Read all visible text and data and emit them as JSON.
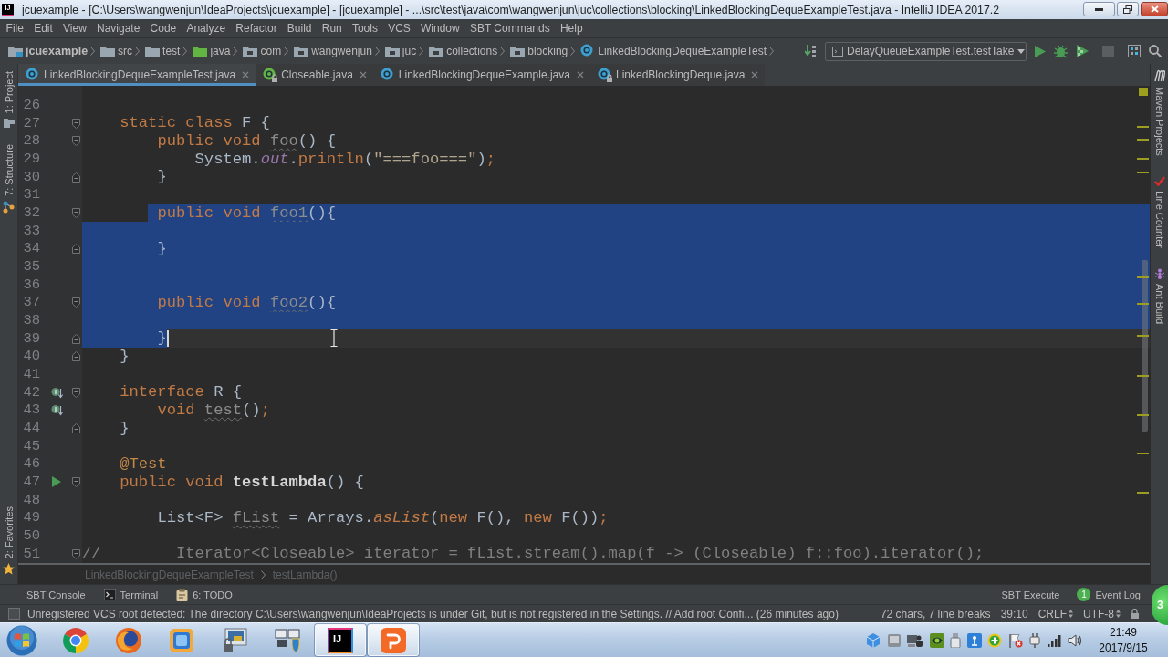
{
  "window": {
    "app_icon_text": "IJ",
    "title": "jcuexample - [C:\\Users\\wangwenjun\\IdeaProjects\\jcuexample] - [jcuexample] - ...\\src\\test\\java\\com\\wangwenjun\\juc\\collections\\blocking\\LinkedBlockingDequeExampleTest.java - IntelliJ IDEA 2017.2"
  },
  "menu": [
    "File",
    "Edit",
    "View",
    "Navigate",
    "Code",
    "Analyze",
    "Refactor",
    "Build",
    "Run",
    "Tools",
    "VCS",
    "Window",
    "SBT Commands",
    "Help"
  ],
  "breadcrumbs": [
    {
      "label": "jcuexample",
      "kind": "module"
    },
    {
      "label": "src",
      "kind": "folder"
    },
    {
      "label": "test",
      "kind": "folder"
    },
    {
      "label": "java",
      "kind": "source-root"
    },
    {
      "label": "com",
      "kind": "package"
    },
    {
      "label": "wangwenjun",
      "kind": "package"
    },
    {
      "label": "juc",
      "kind": "package"
    },
    {
      "label": "collections",
      "kind": "package"
    },
    {
      "label": "blocking",
      "kind": "package"
    },
    {
      "label": "LinkedBlockingDequeExampleTest",
      "kind": "class"
    }
  ],
  "toolbar": [
    {
      "kind": "binary-sort",
      "disabled": false
    },
    {
      "kind": "run-configuration",
      "label": "DelayQueueExampleTest.testTake",
      "disabled": false
    },
    {
      "kind": "run",
      "disabled": false
    },
    {
      "kind": "debug",
      "disabled": false
    },
    {
      "kind": "coverage",
      "disabled": false
    },
    {
      "kind": "stop",
      "disabled": true
    },
    {
      "kind": "project-structure",
      "disabled": false
    },
    {
      "kind": "search",
      "disabled": false
    }
  ],
  "tabs": [
    {
      "label": "LinkedBlockingDequeExampleTest.java",
      "kind": "class",
      "locked": false,
      "selected": true
    },
    {
      "label": "Closeable.java",
      "kind": "interface",
      "locked": true,
      "selected": false
    },
    {
      "label": "LinkedBlockingDequeExample.java",
      "kind": "class",
      "locked": false,
      "selected": false
    },
    {
      "label": "LinkedBlockingDeque.java",
      "kind": "class",
      "locked": true,
      "selected": false
    }
  ],
  "left_tool_windows": {
    "top": [
      {
        "label": "1: Project",
        "kind": "project"
      },
      {
        "label": "7: Structure",
        "kind": "structure"
      }
    ],
    "bottom": [
      {
        "label": "2: Favorites",
        "kind": "favorites"
      }
    ]
  },
  "right_tool_windows": [
    {
      "label": "Maven Projects",
      "kind": "maven"
    },
    {
      "label": "Line Counter",
      "kind": "line-counter"
    },
    {
      "label": "Ant Build",
      "kind": "ant"
    }
  ],
  "editor": {
    "lines": [
      {
        "number": "26",
        "fold_start": false,
        "fold_end": false,
        "implemented": false,
        "runnable": false,
        "selected": false,
        "caret": false
      },
      {
        "number": "27",
        "segments": [
          {
            "text": "    static class",
            "kind": "keyword"
          },
          {
            "text": " F {",
            "kind": "plain"
          }
        ],
        "fold_start": true,
        "fold_end": false,
        "implemented": false,
        "runnable": false,
        "selected": false,
        "caret": false
      },
      {
        "number": "28",
        "segments": [
          {
            "text": "        public void ",
            "kind": "keyword"
          },
          {
            "text": "foo",
            "kind": "unused"
          },
          {
            "text": "() {",
            "kind": "plain"
          }
        ],
        "fold_start": true,
        "fold_end": false,
        "implemented": false,
        "runnable": false,
        "selected": false,
        "caret": false
      },
      {
        "number": "29",
        "segments": [
          {
            "text": "            System.",
            "kind": "plain"
          },
          {
            "text": "out",
            "kind": "field"
          },
          {
            "text": ".",
            "kind": "plain"
          },
          {
            "text": "println",
            "kind": "call"
          },
          {
            "text": "(",
            "kind": "plain"
          },
          {
            "text": "\"===foo===\"",
            "kind": "string"
          },
          {
            "text": ")",
            "kind": "plain"
          },
          {
            "text": ";",
            "kind": "punct"
          }
        ],
        "fold_start": false,
        "fold_end": false,
        "implemented": false,
        "runnable": false,
        "selected": false,
        "caret": false
      },
      {
        "number": "30",
        "segments": [
          {
            "text": "        }",
            "kind": "plain"
          }
        ],
        "fold_start": false,
        "fold_end": true,
        "implemented": false,
        "runnable": false,
        "selected": false,
        "caret": false
      },
      {
        "number": "31",
        "fold_start": false,
        "fold_end": false,
        "implemented": false,
        "runnable": false,
        "selected": false,
        "caret": false
      },
      {
        "number": "32",
        "segments": [
          {
            "text": "        public void ",
            "kind": "keyword"
          },
          {
            "text": "foo1",
            "kind": "unused"
          },
          {
            "text": "(){",
            "kind": "plain"
          }
        ],
        "fold_start": true,
        "fold_end": false,
        "implemented": false,
        "runnable": false,
        "selected": true,
        "caret": false
      },
      {
        "number": "33",
        "fold_start": false,
        "fold_end": false,
        "implemented": false,
        "runnable": false,
        "selected": true,
        "caret": false
      },
      {
        "number": "34",
        "segments": [
          {
            "text": "        }",
            "kind": "plain"
          }
        ],
        "fold_start": false,
        "fold_end": true,
        "implemented": false,
        "runnable": false,
        "selected": true,
        "caret": false
      },
      {
        "number": "35",
        "fold_start": false,
        "fold_end": false,
        "implemented": false,
        "runnable": false,
        "selected": true,
        "caret": false
      },
      {
        "number": "36",
        "fold_start": false,
        "fold_end": false,
        "implemented": false,
        "runnable": false,
        "selected": true,
        "caret": false
      },
      {
        "number": "37",
        "segments": [
          {
            "text": "        public void ",
            "kind": "keyword"
          },
          {
            "text": "foo2",
            "kind": "unused"
          },
          {
            "text": "(){",
            "kind": "plain"
          }
        ],
        "fold_start": true,
        "fold_end": false,
        "implemented": false,
        "runnable": false,
        "selected": true,
        "caret": false
      },
      {
        "number": "38",
        "fold_start": false,
        "fold_end": false,
        "implemented": false,
        "runnable": false,
        "selected": true,
        "caret": false
      },
      {
        "number": "39",
        "segments": [
          {
            "text": "        }",
            "kind": "plain"
          }
        ],
        "fold_start": false,
        "fold_end": true,
        "implemented": false,
        "runnable": false,
        "selected": true,
        "caret": true
      },
      {
        "number": "40",
        "segments": [
          {
            "text": "    }",
            "kind": "plain"
          }
        ],
        "fold_start": false,
        "fold_end": true,
        "implemented": false,
        "runnable": false,
        "selected": false,
        "caret": false
      },
      {
        "number": "41",
        "fold_start": false,
        "fold_end": false,
        "implemented": false,
        "runnable": false,
        "selected": false,
        "caret": false
      },
      {
        "number": "42",
        "segments": [
          {
            "text": "    interface",
            "kind": "keyword"
          },
          {
            "text": " R {",
            "kind": "plain"
          }
        ],
        "fold_start": true,
        "fold_end": false,
        "implemented": true,
        "runnable": false,
        "selected": false,
        "caret": false
      },
      {
        "number": "43",
        "segments": [
          {
            "text": "        void ",
            "kind": "keyword"
          },
          {
            "text": "test",
            "kind": "unused"
          },
          {
            "text": "()",
            "kind": "plain"
          },
          {
            "text": ";",
            "kind": "punct"
          }
        ],
        "fold_start": false,
        "fold_end": false,
        "implemented": true,
        "runnable": false,
        "selected": false,
        "caret": false
      },
      {
        "number": "44",
        "segments": [
          {
            "text": "    }",
            "kind": "plain"
          }
        ],
        "fold_start": false,
        "fold_end": true,
        "implemented": false,
        "runnable": false,
        "selected": false,
        "caret": false
      },
      {
        "number": "45",
        "fold_start": false,
        "fold_end": false,
        "implemented": false,
        "runnable": false,
        "selected": false,
        "caret": false
      },
      {
        "number": "46",
        "segments": [
          {
            "text": "    @Test",
            "kind": "annotation"
          }
        ],
        "fold_start": false,
        "fold_end": false,
        "implemented": false,
        "runnable": false,
        "selected": false,
        "caret": false
      },
      {
        "number": "47",
        "segments": [
          {
            "text": "    public void ",
            "kind": "keyword"
          },
          {
            "text": "testLambda",
            "kind": "declaration"
          },
          {
            "text": "() {",
            "kind": "plain"
          }
        ],
        "fold_start": true,
        "fold_end": false,
        "implemented": false,
        "runnable": true,
        "selected": false,
        "caret": false
      },
      {
        "number": "48",
        "fold_start": false,
        "fold_end": false,
        "implemented": false,
        "runnable": false,
        "selected": false,
        "caret": false
      },
      {
        "number": "49",
        "segments": [
          {
            "text": "        List<F> ",
            "kind": "plain"
          },
          {
            "text": "fList",
            "kind": "unused"
          },
          {
            "text": " = Arrays.",
            "kind": "plain"
          },
          {
            "text": "asList",
            "kind": "static-call"
          },
          {
            "text": "(",
            "kind": "plain"
          },
          {
            "text": "new",
            "kind": "keyword"
          },
          {
            "text": " F(), ",
            "kind": "plain"
          },
          {
            "text": "new",
            "kind": "keyword"
          },
          {
            "text": " F())",
            "kind": "plain"
          },
          {
            "text": ";",
            "kind": "punct"
          }
        ],
        "fold_start": false,
        "fold_end": false,
        "implemented": false,
        "runnable": false,
        "selected": false,
        "caret": false
      },
      {
        "number": "50",
        "fold_start": false,
        "fold_end": false,
        "implemented": false,
        "runnable": false,
        "selected": false,
        "caret": false
      },
      {
        "number": "51",
        "segments": [
          {
            "text": "//        Iterator<Closeable> iterator = fList.stream().map(f -> (Closeable) f::foo).iterator();",
            "kind": "comment"
          }
        ],
        "fold_start": true,
        "fold_end": false,
        "implemented": false,
        "runnable": false,
        "selected": false,
        "caret": false
      }
    ]
  },
  "editor_breadcrumbs": [
    "LinkedBlockingDequeExampleTest",
    "testLambda()"
  ],
  "tool_window_bar": {
    "left": [
      {
        "label": "SBT Console"
      },
      {
        "label": "Terminal",
        "kind": "terminal"
      },
      {
        "label": "6: TODO",
        "kind": "todo"
      }
    ],
    "right": [
      {
        "label": "SBT Execute"
      },
      {
        "label": "Event Log",
        "badge": "1"
      }
    ]
  },
  "status_bar": {
    "message": "Unregistered VCS root detected: The directory C:\\Users\\wangwenjun\\IdeaProjects is under Git, but is not registered in the Settings. // Add root Confi... (26 minutes ago)",
    "selection_info": "72 chars, 7 line breaks",
    "caret_position": "39:10",
    "line_separator": "CRLF",
    "encoding": "UTF-8"
  },
  "floating_badge": "3",
  "taskbar": {
    "apps": [
      {
        "kind": "ring",
        "active": false
      },
      {
        "kind": "globe",
        "active": false
      },
      {
        "kind": "box",
        "active": false
      },
      {
        "kind": "monitor",
        "active": false
      },
      {
        "kind": "shield",
        "active": false
      },
      {
        "kind": "ij",
        "label": "IJ",
        "active": true
      },
      {
        "kind": "ribbon",
        "active": true
      }
    ],
    "time": "21:49",
    "date": "2017/9/15"
  }
}
